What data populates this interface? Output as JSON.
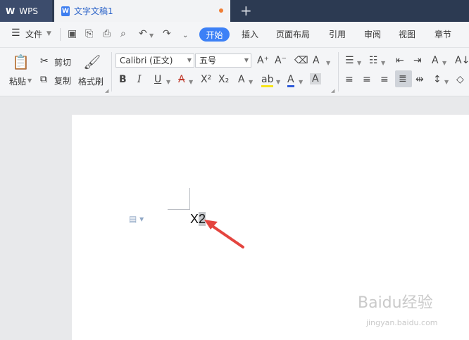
{
  "titlebar": {
    "app_tab_label": "WPS",
    "doc_tab_label": "文字文稿1",
    "new_tab_symbol": "+"
  },
  "menubar": {
    "file_label": "文件",
    "tabs": [
      "开始",
      "插入",
      "页面布局",
      "引用",
      "审阅",
      "视图",
      "章节"
    ],
    "active_tab": "开始"
  },
  "ribbon": {
    "paste_label": "粘贴",
    "cut_label": "剪切",
    "copy_label": "复制",
    "format_painter_label": "格式刷",
    "font_name": "Calibri (正文)",
    "font_size": "五号"
  },
  "document": {
    "text_main": "X",
    "text_selected": "2"
  },
  "watermark": {
    "brand": "Baidu经验",
    "url": "jingyan.baidu.com"
  },
  "colors": {
    "titlebar_bg": "#2c3a52",
    "accent": "#3c80f6",
    "arrow": "#e4453f"
  }
}
